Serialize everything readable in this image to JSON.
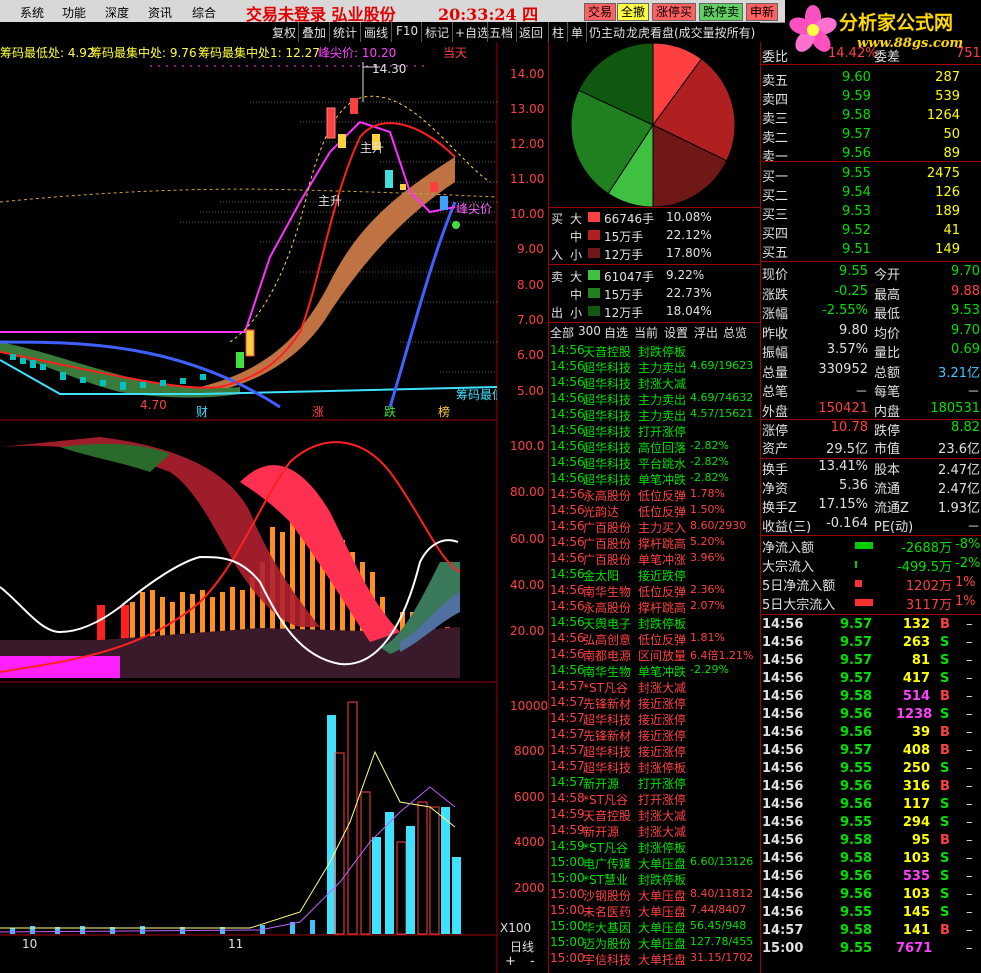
{
  "menu": {
    "items": [
      "系统",
      "功能",
      "深度",
      "资讯",
      "综合"
    ],
    "title": "交易未登录 弘业股份",
    "clock": "20:33:24 四"
  },
  "topbuttons": [
    "交易",
    "全撤",
    "涨停买",
    "跌停卖",
    "申新"
  ],
  "logo": {
    "text": "分析家公式网",
    "url": "www.88gs.com"
  },
  "toolbar": [
    "复权",
    "叠加",
    "统计",
    "画线",
    "F10",
    "标记",
    "+自选",
    "五档",
    "返回",
    "单",
    "仍主动",
    "龙虎看盘(成交量按所有)"
  ],
  "chart": {
    "info": [
      "筹码最低处: 4.92",
      "筹码最集中处: 9.76",
      "筹码最集中处1: 12.27",
      "峰尖价: 10.20"
    ],
    "info_right": "当天",
    "price_high_label": "14.30",
    "price_low_label": "4.70",
    "annotations": {
      "zhusheng1": "主升",
      "zhusheng2": "主升",
      "fengjian": "峰尖价",
      "lowest": "筹码最低"
    },
    "badges": [
      "财",
      "涨",
      "跌",
      "榜"
    ],
    "bottom_ticks": [
      "10",
      "11"
    ],
    "y_main": [
      "14.00",
      "13.00",
      "12.00",
      "11.00",
      "10.00",
      "9.00",
      "8.00",
      "7.00",
      "6.00",
      "5.00"
    ],
    "y_mid": [
      "100.0",
      "80.00",
      "60.00",
      "40.00",
      "20.00"
    ],
    "y_vol": [
      "10000",
      "8000",
      "6000",
      "4000",
      "2000"
    ],
    "vol_unit": "X100",
    "period": "日线"
  },
  "fund": {
    "buy": [
      {
        "k": "大",
        "vol": "66746手",
        "pct": "10.08%"
      },
      {
        "k": "中",
        "vol": "15万手",
        "pct": "22.12%"
      },
      {
        "k": "小",
        "vol": "12万手",
        "pct": "17.80%"
      }
    ],
    "sell": [
      {
        "k": "大",
        "vol": "61047手",
        "pct": "9.22%"
      },
      {
        "k": "中",
        "vol": "15万手",
        "pct": "22.73%"
      },
      {
        "k": "小",
        "vol": "12万手",
        "pct": "18.04%"
      }
    ],
    "buy_label": [
      "买",
      "入"
    ],
    "sell_label": [
      "卖",
      "出"
    ],
    "tabs": [
      "全部",
      "300",
      "自选",
      "当前",
      "设置",
      "浮出",
      "总览"
    ],
    "colors": {
      "big": "#ff4040",
      "mid": "#c02020",
      "small": "#702020",
      "gbig": "#40c040",
      "gmid": "#208020",
      "gsmall": "#105010"
    },
    "pie": [
      {
        "name": "大买",
        "pct": 10.08,
        "color": "#ff4040"
      },
      {
        "name": "中买",
        "pct": 22.12,
        "color": "#b02020"
      },
      {
        "name": "小买",
        "pct": 17.8,
        "color": "#701818"
      },
      {
        "name": "大卖",
        "pct": 9.22,
        "color": "#40c040"
      },
      {
        "name": "中卖",
        "pct": 22.73,
        "color": "#208020"
      },
      {
        "name": "小卖",
        "pct": 18.04,
        "color": "#105810"
      }
    ]
  },
  "feed": [
    {
      "t": "14:56",
      "n": "天音控股",
      "e": "封跌停板",
      "v": "",
      "c": "g"
    },
    {
      "t": "14:56",
      "n": "超华科技",
      "e": "主力卖出",
      "v": "4.69/19623",
      "c": "g"
    },
    {
      "t": "14:56",
      "n": "超华科技",
      "e": "封涨大减",
      "v": "",
      "c": "g"
    },
    {
      "t": "14:56",
      "n": "超华科技",
      "e": "主力卖出",
      "v": "4.69/74632",
      "c": "g"
    },
    {
      "t": "14:56",
      "n": "超华科技",
      "e": "主力卖出",
      "v": "4.57/15621",
      "c": "g"
    },
    {
      "t": "14:56",
      "n": "超华科技",
      "e": "打开涨停",
      "v": "",
      "c": "g"
    },
    {
      "t": "14:56",
      "n": "超华科技",
      "e": "高位回落",
      "v": "-2.82%",
      "c": "g"
    },
    {
      "t": "14:56",
      "n": "超华科技",
      "e": "平台跳水",
      "v": "-2.82%",
      "c": "g"
    },
    {
      "t": "14:56",
      "n": "超华科技",
      "e": "单笔冲跌",
      "v": "-2.82%",
      "c": "g"
    },
    {
      "t": "14:56",
      "n": "永高股份",
      "e": "低位反弹",
      "v": "1.78%",
      "c": "r"
    },
    {
      "t": "14:56",
      "n": "光韵达",
      "e": "低位反弹",
      "v": "1.50%",
      "c": "r"
    },
    {
      "t": "14:56",
      "n": "广百股份",
      "e": "主力买入",
      "v": "8.60/2930",
      "c": "r"
    },
    {
      "t": "14:56",
      "n": "广百股份",
      "e": "撑杆跳高",
      "v": "5.20%",
      "c": "r"
    },
    {
      "t": "14:56",
      "n": "广百股份",
      "e": "单笔冲涨",
      "v": "3.96%",
      "c": "r"
    },
    {
      "t": "14:56",
      "n": "金太阳",
      "e": "接近跌停",
      "v": "",
      "c": "g"
    },
    {
      "t": "14:56",
      "n": "南华生物",
      "e": "低位反弹",
      "v": "2.36%",
      "c": "r"
    },
    {
      "t": "14:56",
      "n": "永高股份",
      "e": "撑杆跳高",
      "v": "2.07%",
      "c": "r"
    },
    {
      "t": "14:56",
      "n": "天舆电子",
      "e": "封跌停板",
      "v": "",
      "c": "g"
    },
    {
      "t": "14:56",
      "n": "弘高创意",
      "e": "低位反弹",
      "v": "1.81%",
      "c": "r"
    },
    {
      "t": "14:56",
      "n": "南都电源",
      "e": "区间放量",
      "v": "6.4倍1.21%",
      "c": "r"
    },
    {
      "t": "14:56",
      "n": "南华生物",
      "e": "单笔冲跌",
      "v": "-2.29%",
      "c": "g"
    },
    {
      "t": "14:57",
      "n": "*ST凡谷",
      "e": "封涨大减",
      "v": "",
      "c": "r"
    },
    {
      "t": "14:57",
      "n": "先锋新材",
      "e": "接近涨停",
      "v": "",
      "c": "r"
    },
    {
      "t": "14:57",
      "n": "超华科技",
      "e": "接近涨停",
      "v": "",
      "c": "r"
    },
    {
      "t": "14:57",
      "n": "先锋新材",
      "e": "接近涨停",
      "v": "",
      "c": "r"
    },
    {
      "t": "14:57",
      "n": "超华科技",
      "e": "接近涨停",
      "v": "",
      "c": "r"
    },
    {
      "t": "14:57",
      "n": "超华科技",
      "e": "封涨停板",
      "v": "",
      "c": "r"
    },
    {
      "t": "14:57",
      "n": "新开源",
      "e": "打开涨停",
      "v": "",
      "c": "g"
    },
    {
      "t": "14:58",
      "n": "*ST凡谷",
      "e": "打开涨停",
      "v": "",
      "c": "r"
    },
    {
      "t": "14:59",
      "n": "天音控股",
      "e": "封涨大减",
      "v": "",
      "c": "r"
    },
    {
      "t": "14:59",
      "n": "新开源",
      "e": "封涨大减",
      "v": "",
      "c": "r"
    },
    {
      "t": "14:59",
      "n": "*ST凡谷",
      "e": "封涨停板",
      "v": "",
      "c": "g"
    },
    {
      "t": "15:00",
      "n": "电广传媒",
      "e": "大单压盘",
      "v": "6.60/13126",
      "c": "g"
    },
    {
      "t": "15:00",
      "n": "*ST慧业",
      "e": "封跌停板",
      "v": "",
      "c": "g"
    },
    {
      "t": "15:00",
      "n": "沙钢股份",
      "e": "大单压盘",
      "v": "8.40/11812",
      "c": "r"
    },
    {
      "t": "15:00",
      "n": "未名医药",
      "e": "大单压盘",
      "v": "7.44/8407",
      "c": "r"
    },
    {
      "t": "15:00",
      "n": "华大基因",
      "e": "大单压盘",
      "v": "56.45/948",
      "c": "g"
    },
    {
      "t": "15:00",
      "n": "迈为股份",
      "e": "大单压盘",
      "v": "127.78/455",
      "c": "g"
    },
    {
      "t": "15:00",
      "n": "宇信科技",
      "e": "大单托盘",
      "v": "31.15/1702",
      "c": "r"
    }
  ],
  "quote": {
    "code": "600128",
    "weibi": {
      "l1": "委比",
      "v1": "14.42%",
      "l2": "委差",
      "v2": "751"
    },
    "asks": [
      {
        "l": "卖五",
        "p": "9.60",
        "v": "287"
      },
      {
        "l": "卖四",
        "p": "9.59",
        "v": "539"
      },
      {
        "l": "卖三",
        "p": "9.58",
        "v": "1264"
      },
      {
        "l": "卖二",
        "p": "9.57",
        "v": "50"
      },
      {
        "l": "卖一",
        "p": "9.56",
        "v": "89"
      }
    ],
    "bids": [
      {
        "l": "买一",
        "p": "9.55",
        "v": "2475"
      },
      {
        "l": "买二",
        "p": "9.54",
        "v": "126"
      },
      {
        "l": "买三",
        "p": "9.53",
        "v": "189"
      },
      {
        "l": "买四",
        "p": "9.52",
        "v": "41"
      },
      {
        "l": "买五",
        "p": "9.51",
        "v": "149"
      }
    ],
    "stats": [
      {
        "l1": "现价",
        "v1": "9.55",
        "c1": "g",
        "l2": "今开",
        "v2": "9.70",
        "c2": "g"
      },
      {
        "l1": "涨跌",
        "v1": "-0.25",
        "c1": "g",
        "l2": "最高",
        "v2": "9.88",
        "c2": "r"
      },
      {
        "l1": "涨幅",
        "v1": "-2.55%",
        "c1": "g",
        "l2": "最低",
        "v2": "9.53",
        "c2": "g"
      },
      {
        "l1": "昨收",
        "v1": "9.80",
        "c1": "w",
        "l2": "均价",
        "v2": "9.70",
        "c2": "g"
      },
      {
        "l1": "振幅",
        "v1": "3.57%",
        "c1": "w",
        "l2": "量比",
        "v2": "0.69",
        "c2": "g"
      },
      {
        "l1": "总量",
        "v1": "330952",
        "c1": "w",
        "l2": "总额",
        "v2": "3.21亿",
        "c2": "c"
      },
      {
        "l1": "总笔",
        "v1": "－",
        "c1": "w",
        "l2": "每笔",
        "v2": "－",
        "c2": "w"
      },
      {
        "l1": "外盘",
        "v1": "150421",
        "c1": "r",
        "l2": "内盘",
        "v2": "180531",
        "c2": "g"
      }
    ],
    "limits": [
      {
        "l1": "涨停",
        "v1": "10.78",
        "c1": "r",
        "l2": "跌停",
        "v2": "8.82",
        "c2": "g"
      },
      {
        "l1": "资产",
        "v1": "29.5亿",
        "c1": "w",
        "l2": "市值",
        "v2": "23.6亿",
        "c2": "w"
      }
    ],
    "fin": [
      {
        "l1": "换手",
        "v1": "13.41%",
        "l2": "股本",
        "v2": "2.47亿"
      },
      {
        "l1": "净资",
        "v1": "5.36",
        "l2": "流通",
        "v2": "2.47亿"
      },
      {
        "l1": "换手Z",
        "v1": "17.15%",
        "l2": "流通Z",
        "v2": "1.93亿"
      },
      {
        "l1": "收益(三)",
        "v1": "-0.164",
        "l2": "PE(动)",
        "v2": "－"
      }
    ],
    "flows": [
      {
        "l": "净流入额",
        "v": "-2688万",
        "p": "-8%",
        "bar": 0.45,
        "bc": "#00d000"
      },
      {
        "l": "大宗流入",
        "v": "-499.5万",
        "p": "-2%",
        "bar": 0.05,
        "bc": "#00d000"
      },
      {
        "l": "5日净流入额",
        "v": "1202万",
        "p": "1%",
        "bar": 0.18,
        "bc": "#ff3030"
      },
      {
        "l": "5日大宗流入",
        "v": "3117万",
        "p": "1%",
        "bar": 0.45,
        "bc": "#ff3030"
      }
    ],
    "ticks": [
      {
        "t": "14:56",
        "p": "9.57",
        "v": "132",
        "d": "B"
      },
      {
        "t": "14:56",
        "p": "9.57",
        "v": "263",
        "d": "S"
      },
      {
        "t": "14:56",
        "p": "9.57",
        "v": "81",
        "d": "S"
      },
      {
        "t": "14:56",
        "p": "9.57",
        "v": "417",
        "d": "S"
      },
      {
        "t": "14:56",
        "p": "9.58",
        "v": "514",
        "d": "B"
      },
      {
        "t": "14:56",
        "p": "9.56",
        "v": "1238",
        "d": "S"
      },
      {
        "t": "14:56",
        "p": "9.56",
        "v": "39",
        "d": "B"
      },
      {
        "t": "14:56",
        "p": "9.57",
        "v": "408",
        "d": "B"
      },
      {
        "t": "14:56",
        "p": "9.55",
        "v": "250",
        "d": "S"
      },
      {
        "t": "14:56",
        "p": "9.56",
        "v": "316",
        "d": "B"
      },
      {
        "t": "14:56",
        "p": "9.56",
        "v": "117",
        "d": "S"
      },
      {
        "t": "14:56",
        "p": "9.55",
        "v": "294",
        "d": "S"
      },
      {
        "t": "14:56",
        "p": "9.58",
        "v": "95",
        "d": "B"
      },
      {
        "t": "14:56",
        "p": "9.58",
        "v": "103",
        "d": "S"
      },
      {
        "t": "14:56",
        "p": "9.56",
        "v": "535",
        "d": "S"
      },
      {
        "t": "14:56",
        "p": "9.56",
        "v": "103",
        "d": "S"
      },
      {
        "t": "14:56",
        "p": "9.55",
        "v": "145",
        "d": "S"
      },
      {
        "t": "14:57",
        "p": "9.58",
        "v": "141",
        "d": "B"
      },
      {
        "t": "15:00",
        "p": "9.55",
        "v": "7671",
        "d": ""
      }
    ]
  }
}
